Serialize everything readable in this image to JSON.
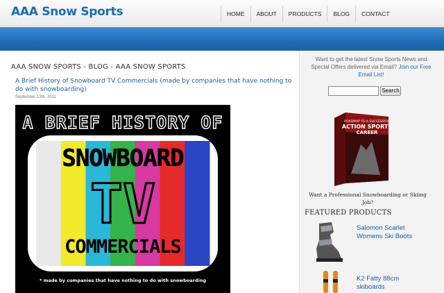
{
  "site": {
    "title": "AAA Snow Sports"
  },
  "nav": {
    "items": [
      "HOME",
      "ABOUT",
      "PRODUCTS",
      "BLOG",
      "CONTACT"
    ]
  },
  "blog": {
    "heading": "AAA SNOW SPORTS - BLOG - AAA SNOW SPORTS",
    "post": {
      "title": "A Brief History of Snowboard TV Commercials (made by companies that have nothing to do with snowboarding)",
      "date": "September 13th, 2011",
      "poster": {
        "line1": "A BRIEF HISTORY OF",
        "line2": "SNOWBOARD",
        "line3": "TV",
        "line4": "COMMERCIALS",
        "tagline": "* made by companies that have nothing to do with snowboarding",
        "bar_colors": [
          "#e9e9e9",
          "#f2ea2a",
          "#2bb8d8",
          "#34b44a",
          "#d63aa0",
          "#e62a2a",
          "#2a45c4"
        ]
      }
    }
  },
  "sidebar": {
    "newsletter_text": "Want to get the latest Snow Sports News and Special Offers delivered via Email?",
    "newsletter_link": "Join our Free Email List!",
    "search_button": "Search",
    "search_placeholder": "",
    "ad": {
      "book_line1": "ROADMAP TO A SUCCESSFUL",
      "book_line2": "ACTION SPORTS",
      "book_line3": "CAREER",
      "caption": "Want a Professional Snowboarding or Skiing Job?"
    },
    "featured_heading": "FEATURED PRODUCTS",
    "products": [
      {
        "name": "Salomon Scarlet Womens Ski Boots"
      },
      {
        "name": "K2 Fatty 88cm skiboards"
      }
    ]
  }
}
